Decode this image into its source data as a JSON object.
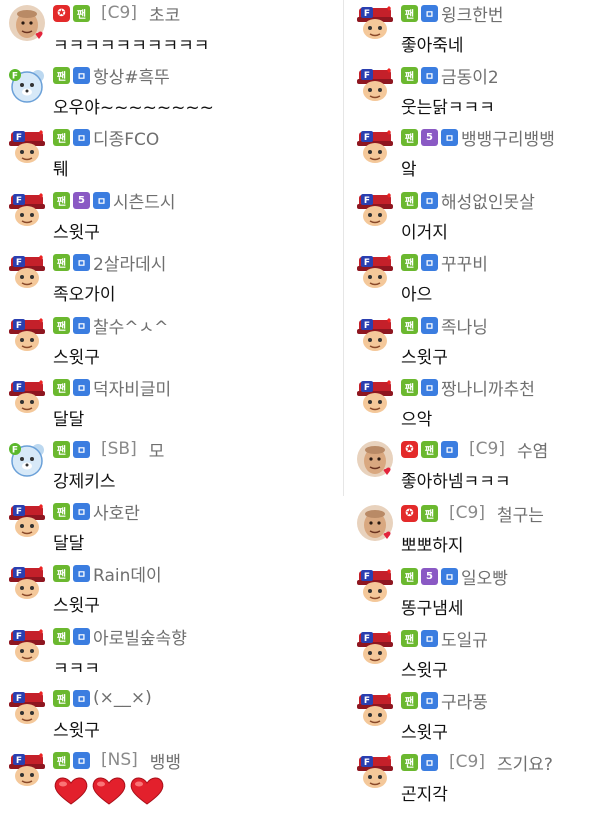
{
  "colors": {
    "fan_badge": "#6bb82f",
    "q_badge": "#3b7de0",
    "five_badge": "#8a59c4",
    "cup_badge": "#e32a2a"
  },
  "badges": {
    "fan": "팬",
    "q": "ㅁ",
    "five": "5",
    "cup": "✪"
  },
  "left": [
    {
      "avatar": "photo-avatar",
      "badges": [
        "cup",
        "fan"
      ],
      "clan": "[C9]",
      "nick": "초코",
      "text": "ㅋㅋㅋㅋㅋㅋㅋㅋㅋㅋ"
    },
    {
      "avatar": "bear-avatar",
      "badges": [
        "fan",
        "q"
      ],
      "clan": "",
      "nick": "항상#흑뚜",
      "text": "오우야~~~~~~~~"
    },
    {
      "avatar": "f-avatar",
      "badges": [
        "fan",
        "q"
      ],
      "clan": "",
      "nick": "디종FCO",
      "text": "퉤"
    },
    {
      "avatar": "f-avatar",
      "badges": [
        "fan",
        "five",
        "q"
      ],
      "clan": "",
      "nick": "시츤드시",
      "text": "스윗구"
    },
    {
      "avatar": "f-avatar",
      "badges": [
        "fan",
        "q"
      ],
      "clan": "",
      "nick": "2살라데시",
      "text": "족오가이"
    },
    {
      "avatar": "f-avatar",
      "badges": [
        "fan",
        "q"
      ],
      "clan": "",
      "nick": "찰수^ㅅ^",
      "text": "스윗구"
    },
    {
      "avatar": "f-avatar",
      "badges": [
        "fan",
        "q"
      ],
      "clan": "",
      "nick": "덕자비글미",
      "text": "달달"
    },
    {
      "avatar": "bear-avatar",
      "badges": [
        "fan",
        "q"
      ],
      "clan": "[SB]",
      "nick": "모",
      "text": "강제키스"
    },
    {
      "avatar": "f-avatar",
      "badges": [
        "fan",
        "q"
      ],
      "clan": "",
      "nick": "사호란",
      "text": "달달"
    },
    {
      "avatar": "f-avatar",
      "badges": [
        "fan",
        "q"
      ],
      "clan": "",
      "nick": "Rain데이",
      "text": "스윗구"
    },
    {
      "avatar": "f-avatar",
      "badges": [
        "fan",
        "q"
      ],
      "clan": "",
      "nick": "아로빌숲속향",
      "text": "ㅋㅋㅋ"
    },
    {
      "avatar": "f-avatar",
      "badges": [
        "fan",
        "q"
      ],
      "clan": "",
      "nick": "(×__×)",
      "text": "스윗구"
    },
    {
      "avatar": "f-avatar",
      "badges": [
        "fan",
        "q"
      ],
      "clan": "[NS]",
      "nick": "뱅뱅",
      "text": "",
      "hearts": 3
    }
  ],
  "right": [
    {
      "avatar": "f-avatar",
      "badges": [
        "fan",
        "q"
      ],
      "clan": "",
      "nick": "윙크한번",
      "text": "좋아죽네"
    },
    {
      "avatar": "f-avatar",
      "badges": [
        "fan",
        "q"
      ],
      "clan": "",
      "nick": "금동이2",
      "text": "웃는닭ㅋㅋㅋ"
    },
    {
      "avatar": "f-avatar",
      "badges": [
        "fan",
        "five",
        "q"
      ],
      "clan": "",
      "nick": "뱅뱅구리뱅뱅",
      "text": "앜"
    },
    {
      "avatar": "f-avatar",
      "badges": [
        "fan",
        "q"
      ],
      "clan": "",
      "nick": "해성없인못살",
      "text": "이거지"
    },
    {
      "avatar": "f-avatar",
      "badges": [
        "fan",
        "q"
      ],
      "clan": "",
      "nick": "꾸꾸비",
      "text": "아으"
    },
    {
      "avatar": "f-avatar",
      "badges": [
        "fan",
        "q"
      ],
      "clan": "",
      "nick": "족나닝",
      "text": "스윗구"
    },
    {
      "avatar": "f-avatar",
      "badges": [
        "fan",
        "q"
      ],
      "clan": "",
      "nick": "짱나니까추천",
      "text": "으악"
    },
    {
      "avatar": "photo-avatar",
      "badges": [
        "cup",
        "fan",
        "q"
      ],
      "clan": "[C9]",
      "nick": "수염",
      "text": "좋아하넴ㅋㅋㅋ"
    },
    {
      "avatar": "photo-avatar",
      "badges": [
        "cup",
        "fan"
      ],
      "clan": "[C9]",
      "nick": "철구는",
      "text": "뽀뽀하지"
    },
    {
      "avatar": "f-avatar",
      "badges": [
        "fan",
        "five",
        "q"
      ],
      "clan": "",
      "nick": "일오빵",
      "text": "똥구냄세"
    },
    {
      "avatar": "f-avatar",
      "badges": [
        "fan",
        "q"
      ],
      "clan": "",
      "nick": "도일규",
      "text": "스윗구"
    },
    {
      "avatar": "f-avatar",
      "badges": [
        "fan",
        "q"
      ],
      "clan": "",
      "nick": "구라풍",
      "text": "스윗구"
    },
    {
      "avatar": "f-avatar",
      "badges": [
        "fan",
        "q"
      ],
      "clan": "[C9]",
      "nick": "즈기요?",
      "text": "곤지각"
    }
  ]
}
